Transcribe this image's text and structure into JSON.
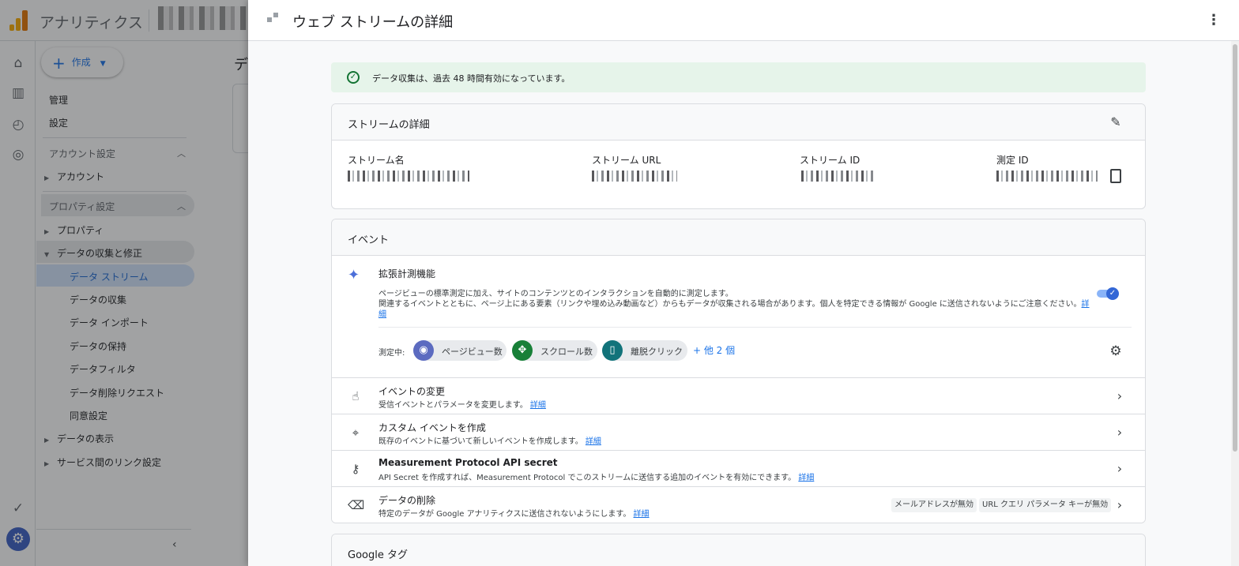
{
  "app": {
    "title": "アナリティクス",
    "create_button": "作成",
    "nav": {
      "admin": "管理",
      "settings": "設定",
      "account_settings": "アカウント設定",
      "account": "アカウント",
      "property_settings": "プロパティ設定",
      "property": "プロパティ",
      "data_collection_modification": "データの収集と修正",
      "sub_items": [
        "データ ストリーム",
        "データの収集",
        "データ インポート",
        "データの保持",
        "データフィルタ",
        "データ削除リクエスト",
        "同意設定"
      ],
      "data_display": "データの表示",
      "service_links": "サービス間のリンク設定"
    },
    "main_title": "デ"
  },
  "drawer": {
    "title": "ウェブ ストリームの詳細",
    "banner": "データ収集は、過去 48 時間有効になっています。",
    "stream_details": {
      "title": "ストリームの詳細",
      "fields": [
        {
          "label": "ストリーム名"
        },
        {
          "label": "ストリーム URL"
        },
        {
          "label": "ストリーム ID"
        },
        {
          "label": "測定 ID"
        }
      ]
    },
    "events": {
      "title": "イベント",
      "enhanced": {
        "title": "拡張計測機能",
        "desc1": "ページビューの標準測定に加え、サイトのコンテンツとのインタラクションを自動的に測定します。",
        "desc2": "関連するイベントとともに、ページ上にある要素（リンクや埋め込み動画など）からもデータが収集される場合があります。個人を特定できる情報が Google に送信されないようにご注意ください。",
        "learn_more": "詳細",
        "toggle_on": true
      },
      "measuring_label": "測定中:",
      "chips": [
        {
          "label": "ページビュー数",
          "icon": "eye-icon",
          "color": "#5c6bc0"
        },
        {
          "label": "スクロール数",
          "icon": "scroll-icon",
          "color": "#188038"
        },
        {
          "label": "離脱クリック",
          "icon": "mouse-icon",
          "color": "#12737a"
        }
      ],
      "more": "+ 他 2 個",
      "rows": [
        {
          "title": "イベントの変更",
          "desc": "受信イベントとパラメータを変更します。",
          "link": "詳細",
          "icon": "touch-icon"
        },
        {
          "title": "カスタム イベントを作成",
          "desc": "既存のイベントに基づいて新しいイベントを作成します。",
          "link": "詳細",
          "icon": "cursor-click-icon"
        },
        {
          "title": "Measurement Protocol API secret",
          "desc": "API Secret を作成すれば、Measurement Protocol でこのストリームに送信する追加のイベントを有効にできます。",
          "link": "詳細",
          "icon": "key-icon"
        },
        {
          "title": "データの削除",
          "desc": "特定のデータが Google アナリティクスに送信されないようにします。",
          "link": "詳細",
          "icon": "eraser-icon"
        }
      ],
      "redaction_tags": [
        "メールアドレスが無効",
        "URL クエリ パラメータ キーが無効"
      ]
    },
    "google_tag": {
      "title": "Google タグ"
    }
  },
  "colors": {
    "accent": "#1a73e8",
    "banner_bg": "#e6f4ea",
    "success": "#137333"
  }
}
